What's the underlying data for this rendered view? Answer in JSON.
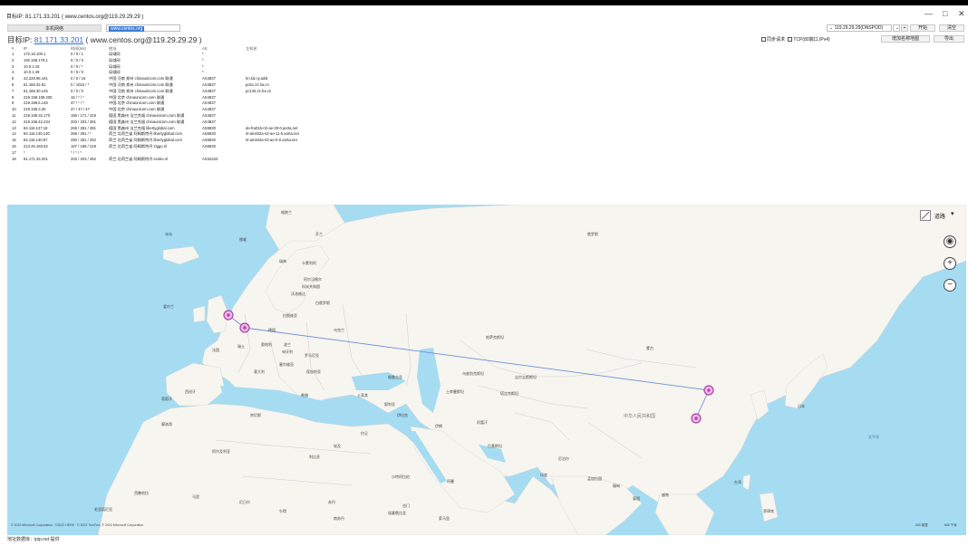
{
  "window": {
    "title": "目标IP: 81.171.33.201 ( www.centos.org@119.29.29.29 )",
    "controls": [
      "—",
      "□",
      "✕"
    ]
  },
  "toolbar": {
    "local_tab": "本机网络",
    "target_input": "www.centos.org",
    "dns_select": "119.29.29.29(DNSPOD)",
    "add_btn": "+",
    "start_btn": "开始",
    "clear_btn": "清空",
    "rename_btn": "增加名称地图",
    "export_btn": "导出"
  },
  "target": {
    "prefix": "目标IP:",
    "ip": "81.171.33.201",
    "domain": "( www.centos.org@119.29.29.29 )"
  },
  "options": {
    "sync_label": "同步请求",
    "tcp_label": "TCP(80端口,IPv4)"
  },
  "table": {
    "headers": [
      "#",
      "IP",
      "时间(ms)",
      "地址",
      "AS",
      "主机名"
    ],
    "rows": [
      [
        "1",
        "172.16.100.1",
        "0 / 0 / 1",
        "局域网",
        "*",
        ""
      ],
      [
        "2",
        "192.168.179.1",
        "0 / 0 / 0",
        "局域网",
        "*",
        ""
      ],
      [
        "3",
        "10.0.1.18",
        "0 / 0 / *",
        "局域网",
        "*",
        ""
      ],
      [
        "4",
        "10.0.1.49",
        "0 / 0 / 0",
        "局域网",
        "*",
        ""
      ],
      [
        "5",
        "42.228.95.161",
        "0 / 0 / 16",
        "中国 河南 郑州 chinaunicom.com 联通",
        "AS4837",
        "hn.kd.ny.adsl"
      ],
      [
        "6",
        "61.168.32.81",
        "0 / 1016 / *",
        "中国 河南 郑州 chinaunicom.com 联通",
        "AS4837",
        "pc61.zz.ha.cn"
      ],
      [
        "7",
        "61.168.30.145",
        "0 / 0 / 0",
        "中国 河南 郑州 chinaunicom.com 联通",
        "AS4837",
        "pc145.zz.ha.cn"
      ],
      [
        "8",
        "219.158.108.205",
        "16 / * / *",
        "中国 北京 chinaunicom.com 联通",
        "AS4837",
        ""
      ],
      [
        "9",
        "219.158.5.146",
        "47 / * / *",
        "中国 北京 chinaunicom.com 联通",
        "AS4837",
        ""
      ],
      [
        "10",
        "219.158.3.30",
        "47 / 47 / 47",
        "中国 北京 chinaunicom.com 联通",
        "AS4837",
        ""
      ],
      [
        "11",
        "219.158.32.170",
        "156 / 171 / 219",
        "德国 黑森州 法兰克福 chinaunicom.com 联通",
        "AS4837",
        ""
      ],
      [
        "12",
        "219.158.42.234",
        "203 / 203 / 281",
        "德国 黑森州 法兰克福 chinaunicom.com 联通",
        "AS4837",
        ""
      ],
      [
        "13",
        "84.116.137.18",
        "266 / 281 / 281",
        "德国 黑森州 法兰克福 libertyglobal.com",
        "AS6830",
        "de-fra01b-ri2-ae-30-0.aorta.net"
      ],
      [
        "14",
        "84.116.130.130",
        "265 / 281 / *",
        "荷兰 北荷兰省 阿姆斯特丹 libertyglobal.com",
        "AS6830",
        "nl-ams02a-ri2-ae-11-0.aorta.net"
      ],
      [
        "15",
        "84.116.130.97",
        "250 / 281 / 282",
        "荷兰 北荷兰省 阿姆斯特丹 libertyglobal.com",
        "AS6830",
        "nl-ams04a-ri3-ae-0-0.aorta.net"
      ],
      [
        "16",
        "213.46.183.62",
        "187 / 188 / 219",
        "荷兰 北荷兰省 阿姆斯特丹 ziggo.nl",
        "AS6830",
        ""
      ],
      [
        "17",
        "*",
        "* / * / *",
        "",
        "",
        ""
      ],
      [
        "18",
        "81.171.33.201",
        "203 / 203 / 282",
        "荷兰 北荷兰省 阿姆斯特丹 evoke.nl",
        "AS34343",
        ""
      ]
    ]
  },
  "map": {
    "layer_label": "道路",
    "countries": {
      "greenland": "格陵兰",
      "iceland": "冰岛",
      "norway": "挪威",
      "finland": "芬兰",
      "sweden": "瑞典",
      "russia": "俄罗斯",
      "karelia": "卡累利阿",
      "arkhangelsk": "阿尔汉格尔",
      "komi": "科米共和国",
      "vologda": "沃洛格达",
      "ireland": "爱尔兰",
      "latvia": "拉脱维亚",
      "belarus": "白俄罗斯",
      "germany": "德国",
      "poland": "波兰",
      "ukraine": "乌克兰",
      "kazakhstan": "哈萨克斯坦",
      "mongolia": "蒙古",
      "france": "法国",
      "switzerland": "瑞士",
      "austria": "奥地利",
      "hungary": "匈牙利",
      "romania": "罗马尼亚",
      "serbia": "塞尔维亚",
      "bulgaria": "保加利亚",
      "spain": "西班牙",
      "italy": "意大利",
      "portugal": "葡萄牙",
      "georgia": "格鲁吉亚",
      "uzbekistan": "乌兹别克斯坦",
      "kyrgyzstan": "吉尔吉斯斯坦",
      "turkmenistan": "土库曼斯坦",
      "tajikistan": "塔吉克斯坦",
      "turkey": "土耳其",
      "greece": "希腊",
      "china": "中华人民共和国",
      "japan": "日本",
      "morocco": "摩洛哥",
      "algeria": "阿尔及利亚",
      "tunisia": "突尼斯",
      "libya": "利比亚",
      "syria": "叙利亚",
      "iraq": "伊拉克",
      "iran": "伊朗",
      "afghanistan": "阿富汗",
      "pakistan": "巴基斯坦",
      "jordan": "约旦",
      "egypt": "埃及",
      "saudi": "沙特阿拉伯",
      "oman": "阿曼",
      "yemen": "也门",
      "india": "印度",
      "nepal": "尼泊尔",
      "bangladesh": "孟加拉国",
      "myanmar": "缅甸",
      "thailand": "泰国",
      "vietnam": "越南",
      "philippines": "菲律宾",
      "taiwan": "台湾",
      "mauritania": "毛里塔尼亚",
      "mali": "马里",
      "niger": "尼日尔",
      "chad": "乍得",
      "sudan": "苏丹",
      "ethiopia": "埃塞俄比亚",
      "south_sudan": "南苏丹",
      "somalia": "索马里",
      "west_sahara": "西撒哈拉",
      "pacific": "太平洋"
    },
    "copyright": "© 2022 Microsoft Corporation · ©2022 HERE · © 2022 TomTom, © 2022 Microsoft Corporation",
    "scale_left": "200 英里",
    "scale_right": "500 千米"
  },
  "status": {
    "text": "地址数据库：ipip.net 提供"
  },
  "colors": {
    "sea": "#a5dcf2",
    "land": "#f7f5ef",
    "route": "#6d8fd6",
    "marker": "#b145a8",
    "link": "#2f6fd0"
  }
}
